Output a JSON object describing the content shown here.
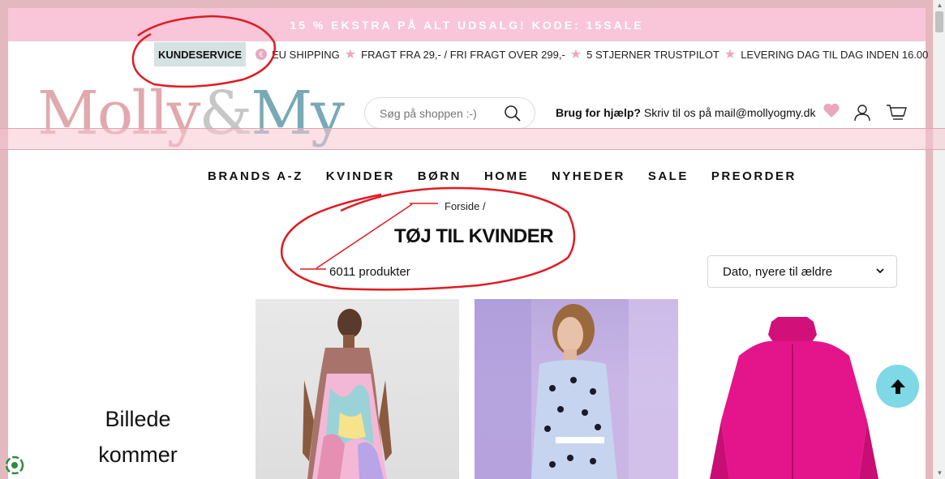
{
  "announcement": {
    "text": "15 % EKSTRA PÅ ALT UDSALG! KODE: 15SALE"
  },
  "topbar": {
    "kundeservice": "KUNDESERVICE",
    "items": [
      "EU SHIPPING",
      "FRAGT FRA 29,- / FRI FRAGT OVER 299,-",
      "5 STJERNER TRUSTPILOT",
      "LEVERING DAG TIL DAG INDEN 16.00"
    ]
  },
  "logo": {
    "part1": "Molly",
    "amp": "&",
    "part2": "My"
  },
  "search": {
    "placeholder": "Søg på shoppen :-)"
  },
  "help": {
    "bold": "Brug for hjælp?",
    "text": " Skriv til os på mail@mollyogmy.dk"
  },
  "nav": {
    "items": [
      "BRANDS A-Z",
      "KVINDER",
      "BØRN",
      "HOME",
      "NYHEDER",
      "SALE",
      "PREORDER"
    ]
  },
  "breadcrumb": {
    "home": "Forside",
    "separator": "/"
  },
  "page": {
    "title": "TØJ TIL KVINDER",
    "count": "6011 produkter"
  },
  "sort": {
    "selected": "Dato, nyere til ældre"
  },
  "placeholder": {
    "line1": "Billede",
    "line2": "kommer"
  },
  "colors": {
    "announce_bg": "#f8c6d8",
    "kundeservice_bg": "#d4e2e4",
    "star": "#e8a9bf",
    "totop": "#7ed8e6",
    "annotation": "#e11b22"
  },
  "icons": [
    "search-icon",
    "heart-icon",
    "user-icon",
    "cart-icon",
    "arrow-up-icon",
    "chevron-down-icon",
    "star-icon"
  ]
}
